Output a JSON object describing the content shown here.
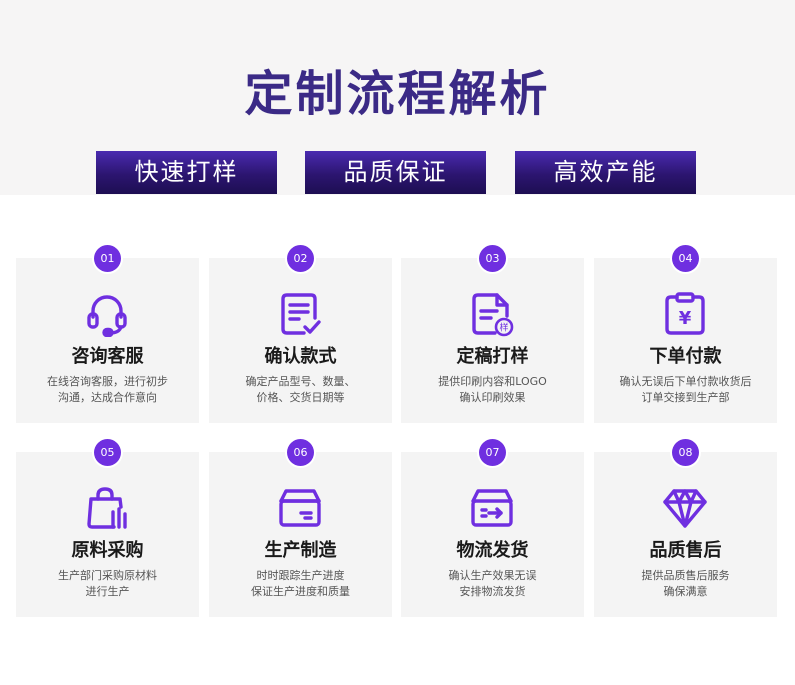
{
  "header": {
    "title": "定制流程解析"
  },
  "features": [
    {
      "label": "快速打样"
    },
    {
      "label": "品质保证"
    },
    {
      "label": "高效产能"
    }
  ],
  "accent_color": "#6f2fe0",
  "title_color": "#3b2a86",
  "steps": [
    {
      "number": "01",
      "title": "咨询客服",
      "desc": [
        "在线咨询客服，进行初步",
        "沟通，达成合作意向"
      ],
      "icon": "headset-icon"
    },
    {
      "number": "02",
      "title": "确认款式",
      "desc": [
        "确定产品型号、数量、",
        "价格、交货日期等"
      ],
      "icon": "document-check-icon"
    },
    {
      "number": "03",
      "title": "定稿打样",
      "desc": [
        "提供印刷内容和LOGO",
        "确认印刷效果"
      ],
      "icon": "sample-document-icon"
    },
    {
      "number": "04",
      "title": "下单付款",
      "desc": [
        "确认无误后下单付款收货后",
        "订单交接到生产部"
      ],
      "icon": "payment-clipboard-icon"
    },
    {
      "number": "05",
      "title": "原料采购",
      "desc": [
        "生产部门采购原材料",
        "进行生产"
      ],
      "icon": "shopping-bag-icon"
    },
    {
      "number": "06",
      "title": "生产制造",
      "desc": [
        "时时跟踪生产进度",
        "保证生产进度和质量"
      ],
      "icon": "box-icon"
    },
    {
      "number": "07",
      "title": "物流发货",
      "desc": [
        "确认生产效果无误",
        "安排物流发货"
      ],
      "icon": "shipping-box-icon"
    },
    {
      "number": "08",
      "title": "品质售后",
      "desc": [
        "提供品质售后服务",
        "确保满意"
      ],
      "icon": "diamond-icon"
    }
  ]
}
